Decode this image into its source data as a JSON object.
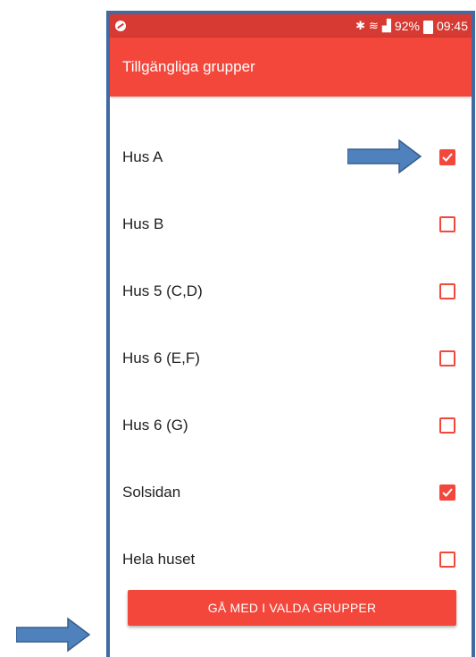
{
  "status_bar": {
    "battery": "92%",
    "time": "09:45",
    "icons": [
      "notification-icon",
      "bluetooth-icon",
      "wifi-icon",
      "signal-icon",
      "battery-icon"
    ]
  },
  "app_bar": {
    "title": "Tillgängliga grupper"
  },
  "groups": [
    {
      "label": "Hus A",
      "checked": true
    },
    {
      "label": "Hus B",
      "checked": false
    },
    {
      "label": "Hus 5 (C,D)",
      "checked": false
    },
    {
      "label": "Hus 6 (E,F)",
      "checked": false
    },
    {
      "label": "Hus 6 (G)",
      "checked": false
    },
    {
      "label": "Solsidan",
      "checked": true
    },
    {
      "label": "Hela huset",
      "checked": false
    }
  ],
  "join_button": {
    "label": "GÅ MED I VALDA GRUPPER"
  },
  "colors": {
    "accent": "#f3473c",
    "status_bar": "#d63a32",
    "frame": "#3f6aa2",
    "annotation_arrow": "#4f81bd"
  }
}
